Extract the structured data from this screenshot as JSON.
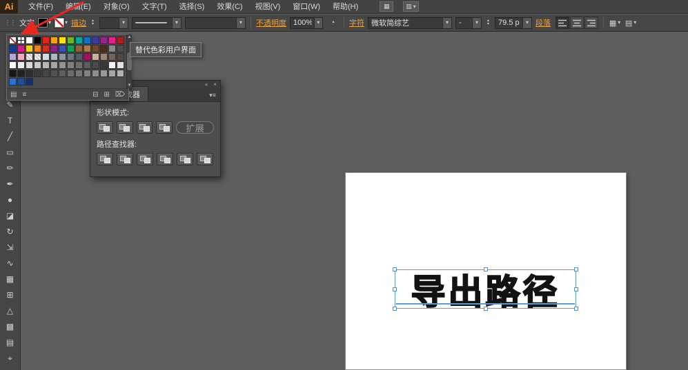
{
  "titlebar": {
    "logo": "Ai",
    "menus": [
      {
        "id": "file",
        "label": "文件(F)"
      },
      {
        "id": "edit",
        "label": "编辑(E)"
      },
      {
        "id": "object",
        "label": "对象(O)"
      },
      {
        "id": "type",
        "label": "文字(T)"
      },
      {
        "id": "select",
        "label": "选择(S)"
      },
      {
        "id": "effect",
        "label": "效果(C)"
      },
      {
        "id": "view",
        "label": "视图(V)"
      },
      {
        "id": "window",
        "label": "窗口(W)"
      },
      {
        "id": "help",
        "label": "帮助(H)"
      }
    ]
  },
  "controlbar": {
    "context_label": "文字",
    "stroke_label": "描边",
    "opacity_label": "不透明度",
    "opacity_value": "100%",
    "character_label": "字符",
    "font_name": "微软简综艺",
    "font_style": "-",
    "font_size": "79.5 p",
    "paragraph_label": "段落"
  },
  "tooltip": {
    "text": "替代色彩用户界面"
  },
  "swatches_panel": {
    "rows": [
      [
        "none",
        "reg",
        "#ffffff",
        "#000000",
        "#e2231a",
        "#f6a21d",
        "#ffe307",
        "#6cb52d",
        "#00a99d",
        "#1471c8",
        "#3a3a9f",
        "#93268f",
        "#ea1f8e",
        "#a81e22"
      ],
      [
        "#123f93",
        "#d21f86",
        "#f7d117",
        "#ef8022",
        "#d92c20",
        "#8c2387",
        "#3f51b5",
        "#0f9d58",
        "#8c6239",
        "#a97c50",
        "#6d4b2c",
        "#472d18",
        "#8a8a8a",
        "#4d4d4d"
      ],
      [
        "#b2a6d4",
        "#f2a7c3",
        "pattern",
        "pattern",
        "#d5dbde",
        "#aeb9bf",
        "#8a969e",
        "#6a7680",
        "#515d66",
        "#a2135f",
        "#c7b299",
        "#998675",
        "#736357",
        "#534741"
      ],
      [
        "#ffffff",
        "#ededed",
        "#dbdbdb",
        "#c9c9c9",
        "#b7b7b7",
        "#a5a5a5",
        "#939393",
        "#818181",
        "#6f6f6f",
        "#5d5d5d",
        "#4b4b4b",
        "#393939",
        "#f6f6f6",
        "#e3e3e3"
      ],
      [
        "#161616",
        "#222222",
        "#2e2e2e",
        "#3a3a3a",
        "#464646",
        "#525252",
        "#5e5e5e",
        "#6a6a6a",
        "#767676",
        "#828282",
        "#8e8e8e",
        "#9a9a9a",
        "#a6a6a6",
        "#b2b2b2"
      ],
      [
        "#2f6fd0",
        "#1f4da0",
        "#15306b",
        "empty",
        "empty",
        "empty",
        "empty",
        "empty",
        "empty",
        "empty",
        "empty",
        "empty",
        "empty",
        "empty"
      ]
    ]
  },
  "pathfinder_panel": {
    "tab_label": "路径查找器",
    "shape_modes_label": "形状模式:",
    "expand_button": "扩展",
    "pathfinders_label": "路径查找器:",
    "shape_mode_buttons": [
      "unite",
      "minus-front",
      "intersect",
      "exclude"
    ],
    "pathfinder_buttons": [
      "divide",
      "trim",
      "merge",
      "crop",
      "outline",
      "minus-back"
    ]
  },
  "toolbar": {
    "tools": [
      {
        "name": "selection",
        "glyph": "▶"
      },
      {
        "name": "direct-selection",
        "glyph": "▷"
      },
      {
        "name": "magic-wand",
        "glyph": "✶"
      },
      {
        "name": "lasso",
        "glyph": "◌"
      },
      {
        "name": "pen",
        "glyph": "✎"
      },
      {
        "name": "type",
        "glyph": "T"
      },
      {
        "name": "line-segment",
        "glyph": "╱"
      },
      {
        "name": "rectangle",
        "glyph": "▭"
      },
      {
        "name": "paintbrush",
        "glyph": "✏"
      },
      {
        "name": "pencil",
        "glyph": "✒"
      },
      {
        "name": "blob-brush",
        "glyph": "●"
      },
      {
        "name": "eraser",
        "glyph": "◪"
      },
      {
        "name": "rotate",
        "glyph": "↻"
      },
      {
        "name": "scale",
        "glyph": "⇲"
      },
      {
        "name": "width",
        "glyph": "∿"
      },
      {
        "name": "free-transform",
        "glyph": "▦"
      },
      {
        "name": "shape-builder",
        "glyph": "⊞"
      },
      {
        "name": "perspective-grid",
        "glyph": "△"
      },
      {
        "name": "mesh",
        "glyph": "▩"
      },
      {
        "name": "gradient",
        "glyph": "▤"
      },
      {
        "name": "eyedropper",
        "glyph": "⌖"
      }
    ]
  },
  "canvas": {
    "artboard_text": "导出路径"
  },
  "colors": {
    "link_accent": "#eea23e",
    "selection_blue": "#5b9bd5",
    "annotation_red": "#e8281e",
    "fill_swatch": "#000000"
  },
  "icons": {
    "chevron_down": "▾",
    "spinner_up": "▴",
    "spinner_down": "▾",
    "collapse": "«",
    "close": "×",
    "panel_menu": "▾≡",
    "scroll_up": "▲",
    "scroll_down": "▼",
    "grip": "⋮⋮",
    "libraries": "▤",
    "kinds": "≡",
    "group": "⊟",
    "new": "⊞",
    "trash": "⌦",
    "arrange": "▦",
    "workspace": "▥",
    "recolor": "◔",
    "align_dd": "▦",
    "options_dd": "▤"
  }
}
